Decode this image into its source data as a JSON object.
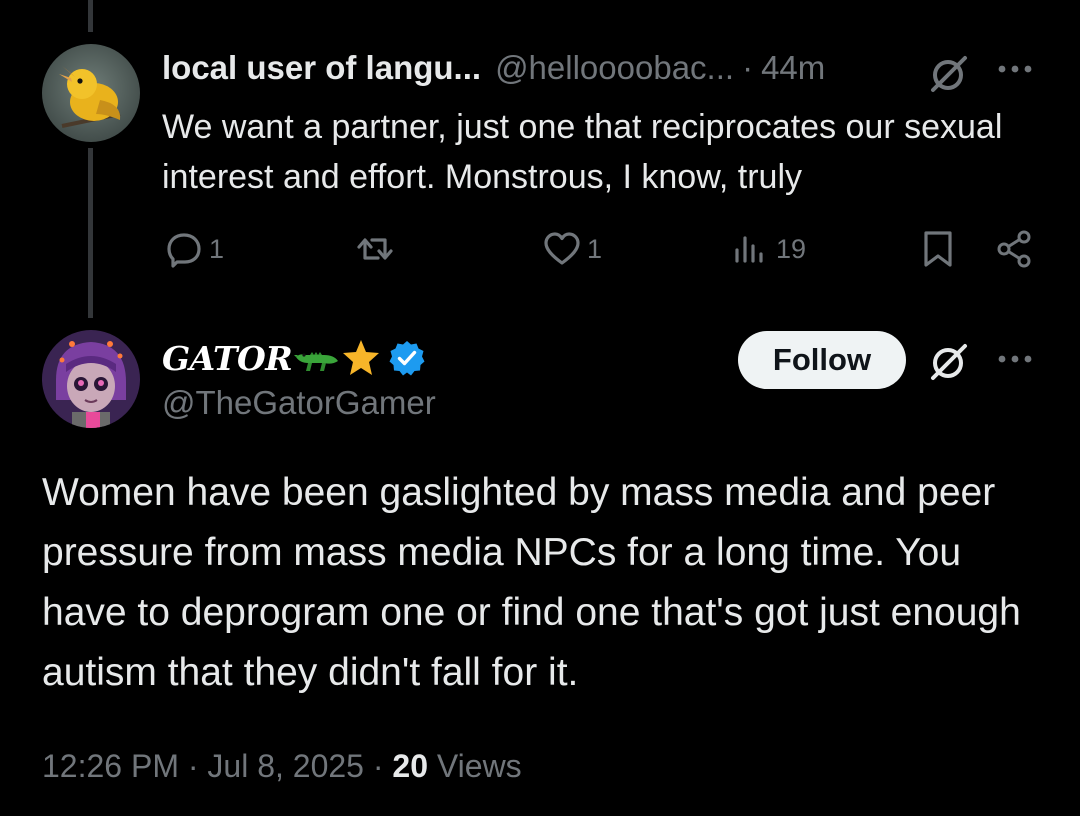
{
  "reply": {
    "display_name": "local user of langu...",
    "handle": "@helloooobac...",
    "separator": "·",
    "time": "44m",
    "text": "We want a partner, just one that reciprocates our sexual interest and effort. Monstrous, I know, truly",
    "actions": {
      "replies": "1",
      "reposts": "",
      "likes": "1",
      "views": "19"
    },
    "avatar_icon": "yellow-bird-avatar"
  },
  "main": {
    "display_name": "GATOR",
    "emojis": [
      "crocodile-emoji",
      "star-emoji"
    ],
    "verified_icon": "verified-badge-icon",
    "handle": "@TheGatorGamer",
    "follow_label": "Follow",
    "text": "Women have been gaslighted by mass media and peer pressure from mass media NPCs for a long time. You have to deprogram one or find one that's got just enough autism that they didn't fall for it.",
    "meta": {
      "time": "12:26 PM",
      "dot1": "·",
      "date": "Jul 8, 2025",
      "dot2": "·",
      "views_count": "20",
      "views_label": "Views"
    },
    "avatar_icon": "purple-character-avatar"
  },
  "colors": {
    "background": "#000000",
    "text": "#e7e9ea",
    "muted": "#71767b",
    "verified": "#1d9bf0",
    "follow_bg": "#eff3f4",
    "thread_line": "#333639"
  }
}
